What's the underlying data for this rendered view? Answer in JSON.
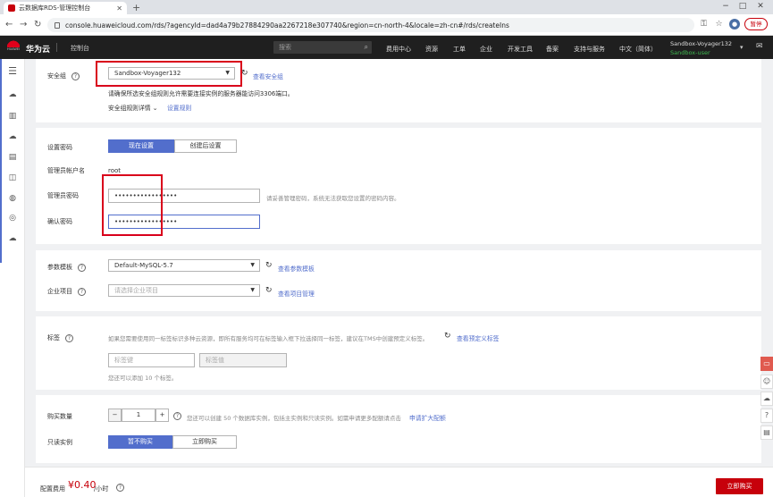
{
  "browser": {
    "tab_title": "云数据库RDS-管理控制台",
    "url": "console.huaweicloud.com/rds/?agencyId=dad4a79b27884290aa2267218e307740&region=cn-north-4&locale=zh-cn#/rds/createIns",
    "pause_label": "暂停"
  },
  "header": {
    "logo_text": "HUAWEI",
    "brand": "华为云",
    "console_link": "控制台",
    "search_placeholder": "搜索",
    "nav": [
      "费用中心",
      "资源",
      "工单",
      "企业",
      "开发工具",
      "备案",
      "支持与服务",
      "中文（简体）"
    ],
    "user_name": "Sandbox-Voyager132",
    "user_sub": "Sandbox-user"
  },
  "security": {
    "label": "安全组",
    "selected": "Sandbox-Voyager132",
    "view_link": "查看安全组",
    "note": "请确保所选安全组规则允许需要连接实例的服务器能访问3306端口。",
    "rules_label": "安全组规则详情",
    "rules_link": "设置规则"
  },
  "password": {
    "setting_label": "设置密码",
    "seg_now": "现在设置",
    "seg_later": "创建后设置",
    "admin_label": "管理员帐户名",
    "admin_value": "root",
    "pwd_label": "管理员密码",
    "pwd_value": "•••••••••••••••••",
    "pwd_hint": "请妥善管理密码，系统无法获取您设置的密码内容。",
    "confirm_label": "确认密码",
    "confirm_value": "•••••••••••••••••"
  },
  "params": {
    "template_label": "参数模板",
    "template_value": "Default-MySQL-5.7",
    "template_link": "查看参数模板",
    "project_label": "企业项目",
    "project_placeholder": "请选择企业项目",
    "project_link": "查看项目管理"
  },
  "tags": {
    "label": "标签",
    "desc": "如果您需要使用同一标签标识多种云资源，即所有服务均可在标签输入框下拉选择同一标签，建议在TMS中创建预定义标签。",
    "desc_link": "查看预定义标签",
    "key_placeholder": "标签键",
    "value_placeholder": "标签值",
    "count_note": "您还可以添加 10 个标签。"
  },
  "purchase": {
    "qty_label": "购买数量",
    "qty_minus": "−",
    "qty_value": "1",
    "qty_plus": "+",
    "qty_note": "您还可以创建 50 个数据库实例，包括主实例和只读实例。如需申请更多配额请点击",
    "qty_link": "申请扩大配额",
    "readonly_label": "只读实例",
    "seg_no": "暂不购买",
    "seg_buy": "立即购买"
  },
  "footer": {
    "fee_label": "配置费用",
    "price": "¥0.40",
    "unit": "/小时",
    "buy_button": "立即购买"
  },
  "colors": {
    "accent": "#526ecc",
    "brand_red": "#c7000b",
    "highlight": "#d9001b"
  }
}
